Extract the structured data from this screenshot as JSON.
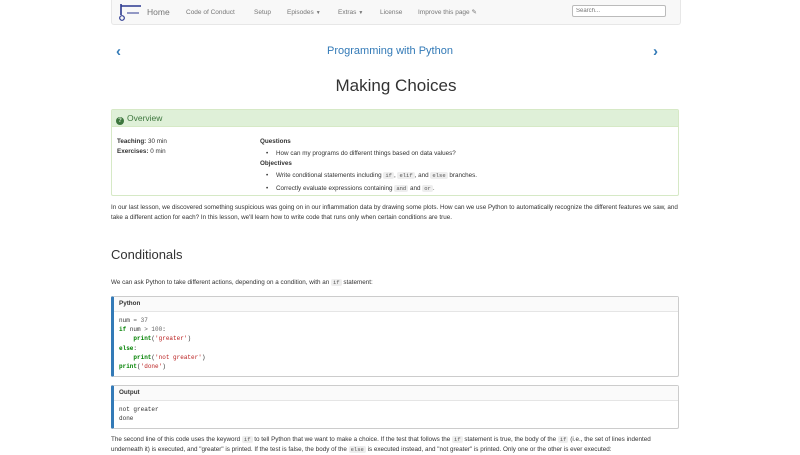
{
  "nav": {
    "home": "Home",
    "items": [
      "Code of Conduct",
      "Setup",
      "Episodes",
      "Extras",
      "License",
      "Improve this page"
    ],
    "edit_icon": "pencil-icon",
    "search_placeholder": "Search..."
  },
  "lesson": {
    "title": "Programming with Python",
    "prev_icon": "chevron-left-icon",
    "next_icon": "chevron-right-icon"
  },
  "page_title": "Making Choices",
  "overview": {
    "title": "Overview",
    "teaching_label": "Teaching:",
    "teaching_value": "30 min",
    "exercises_label": "Exercises:",
    "exercises_value": "0 min",
    "questions_label": "Questions",
    "question_1": "How can my programs do different things based on data values?",
    "objectives_label": "Objectives",
    "obj1": {
      "a": "Write conditional statements including",
      "c1": "if",
      "b": ",",
      "c2": "elif",
      "c": ", and",
      "c3": "else",
      "d": "branches."
    },
    "obj2": {
      "a": "Correctly evaluate expressions containing",
      "c1": "and",
      "b": "and",
      "c2": "or",
      "c": "."
    }
  },
  "intro": "In our last lesson, we discovered something suspicious was going on in our inflammation data by drawing some plots. How can we use Python to automatically recognize the different features we saw, and take a different action for each? In this lesson, we'll learn how to write code that runs only when certain conditions are true.",
  "section_title": "Conditionals",
  "cond_para": {
    "a": "We can ask Python to take different actions, depending on a condition, with an",
    "code": "if",
    "b": "statement:"
  },
  "code_block": {
    "label": "Python",
    "l1": {
      "a": "num",
      "b": " = ",
      "c": "37"
    },
    "l2": {
      "kw": "if",
      "a": " num ",
      "b": ">",
      "c": " 100",
      "d": ":"
    },
    "l3": {
      "fn": "print",
      "a": "(",
      "s": "'greater'",
      "b": ")"
    },
    "l4": {
      "kw": "else",
      "a": ":"
    },
    "l5": {
      "fn": "print",
      "a": "(",
      "s": "'not greater'",
      "b": ")"
    },
    "l6": {
      "fn": "print",
      "a": "(",
      "s": "'done'",
      "b": ")"
    }
  },
  "output_block": {
    "label": "Output",
    "lines": [
      "not greater",
      "done"
    ]
  },
  "bottom_para": {
    "a": "The second line of this code uses the keyword",
    "c1": "if",
    "b": "to tell Python that we want to make a choice. If the test that follows the",
    "c2": "if",
    "c": "statement is true, the body of the",
    "c3": "if",
    "d": "(i.e., the set of lines indented underneath it) is executed, and \"greater\" is printed. If the test is false, the body of the",
    "c4": "else",
    "e": "is executed instead, and \"not greater\" is printed. Only one or the other is ever executed:"
  }
}
